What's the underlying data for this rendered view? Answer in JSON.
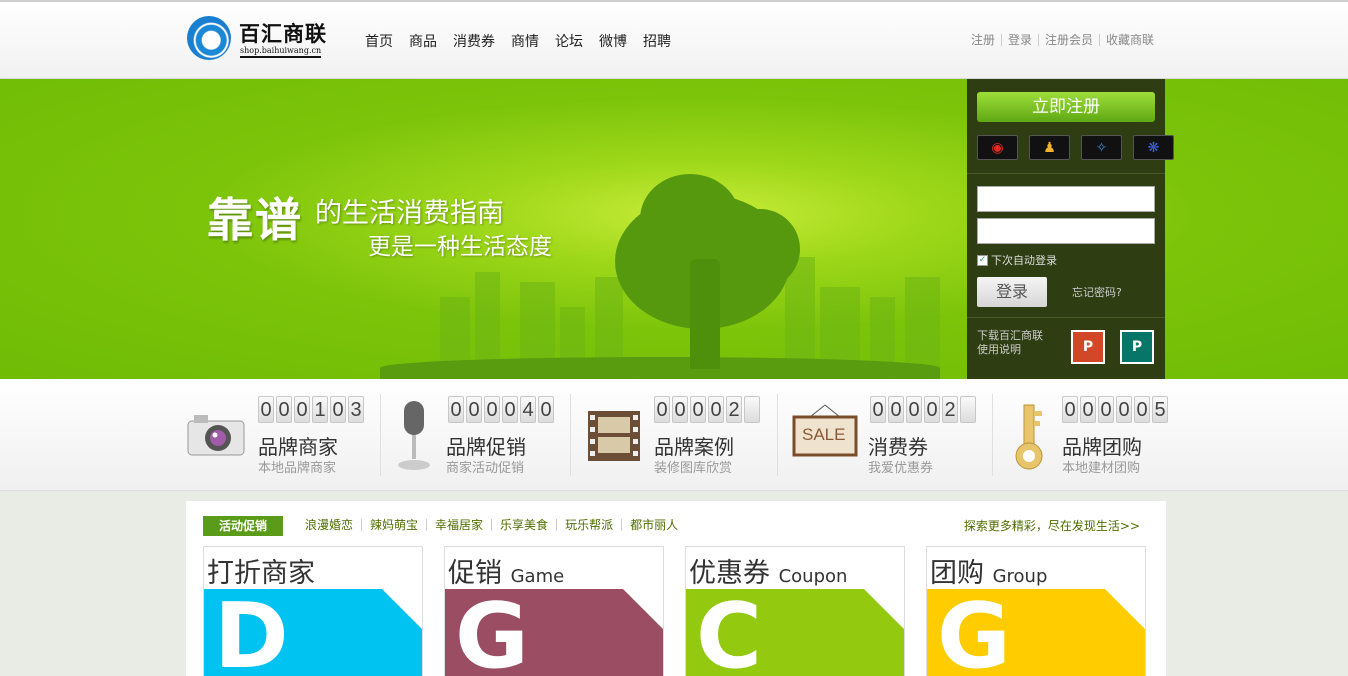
{
  "header": {
    "logo_text": "百汇商联",
    "logo_sub": "shop.baihuiwang.cn",
    "nav": [
      "首页",
      "商品",
      "消费券",
      "商情",
      "论坛",
      "微博",
      "招聘"
    ],
    "top_links": [
      "注册",
      "登录",
      "注册会员",
      "收藏商联"
    ]
  },
  "banner": {
    "slogan_big": "靠谱",
    "slogan_line1": "的生活消费指南",
    "slogan_line2": "更是一种生活态度"
  },
  "login": {
    "register_label": "立即注册",
    "social_icons": [
      "weibo-icon",
      "qq-icon",
      "tencent-weibo-icon",
      "baidu-icon"
    ],
    "auto_login": "下次自动登录",
    "auto_login_checked": true,
    "login_label": "登录",
    "forgot": "忘记密码?",
    "download_text": "下载百汇商联使用说明",
    "ppt_label": "P",
    "pub_label": "P"
  },
  "stats": [
    {
      "title": "品牌商家",
      "sub": "本地品牌商家",
      "digits": [
        "0",
        "0",
        "0",
        "1",
        "0",
        "3"
      ],
      "icon": "camera-icon"
    },
    {
      "title": "品牌促销",
      "sub": "商家活动促销",
      "digits": [
        "0",
        "0",
        "0",
        "0",
        "4",
        "0"
      ],
      "icon": "microphone-icon"
    },
    {
      "title": "品牌案例",
      "sub": "装修图库欣赏",
      "digits": [
        "0",
        "0",
        "0",
        "0",
        "2",
        ""
      ],
      "icon": "film-icon"
    },
    {
      "title": "消费券",
      "sub": "我爱优惠券",
      "digits": [
        "0",
        "0",
        "0",
        "0",
        "2",
        ""
      ],
      "icon": "sale-sign-icon",
      "sale_text": "SALE"
    },
    {
      "title": "品牌团购",
      "sub": "本地建材团购",
      "digits": [
        "0",
        "0",
        "0",
        "0",
        "0",
        "5"
      ],
      "icon": "key-icon"
    }
  ],
  "promo": {
    "label": "活动促销",
    "categories": [
      "浪漫婚恋",
      "辣妈萌宝",
      "幸福居家",
      "乐享美食",
      "玩乐帮派",
      "都市丽人"
    ],
    "more": "探索更多精彩，尽在发现生活>>",
    "cards": [
      {
        "title": "打折商家",
        "en": "",
        "letter": "D",
        "color": "#00c3f2"
      },
      {
        "title": "促销",
        "en": "Game",
        "letter": "G",
        "color": "#9a4d63"
      },
      {
        "title": "优惠券",
        "en": "Coupon",
        "letter": "C",
        "color": "#93c90f"
      },
      {
        "title": "团购",
        "en": "Group",
        "letter": "G",
        "color": "#ffcc00"
      }
    ]
  }
}
